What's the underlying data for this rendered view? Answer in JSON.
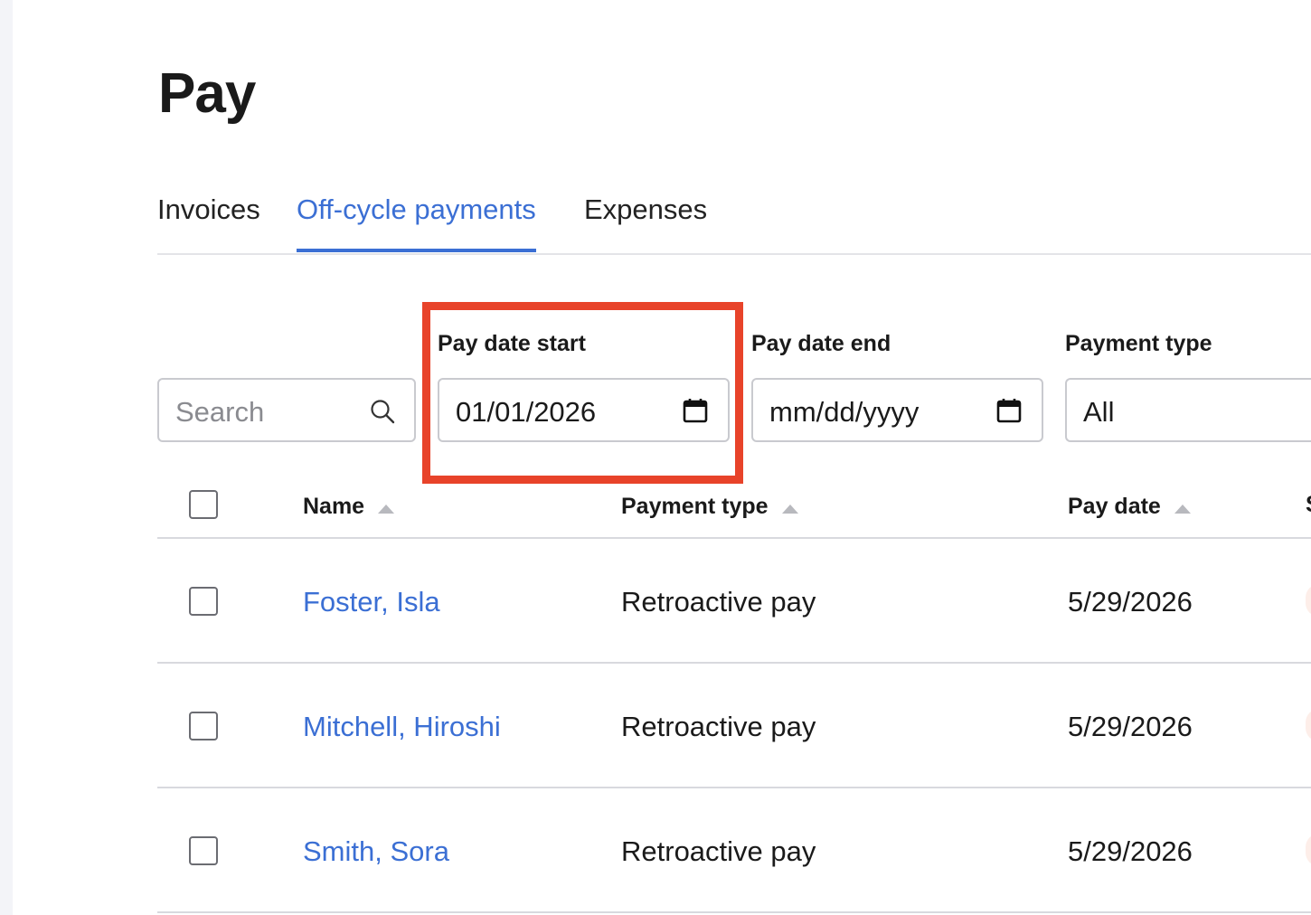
{
  "page": {
    "title": "Pay"
  },
  "tabs": [
    {
      "label": "Invoices",
      "active": false
    },
    {
      "label": "Off-cycle payments",
      "active": true
    },
    {
      "label": "Expenses",
      "active": false
    }
  ],
  "filters": {
    "search": {
      "placeholder": "Search",
      "value": ""
    },
    "pay_date_start": {
      "label": "Pay date start",
      "value": "01/01/2026"
    },
    "pay_date_end": {
      "label": "Pay date end",
      "placeholder": "mm/dd/yyyy"
    },
    "payment_type": {
      "label": "Payment type",
      "value": "All"
    }
  },
  "table": {
    "columns": [
      "Name",
      "Payment type",
      "Pay date",
      "S"
    ],
    "rows": [
      {
        "name": "Foster, Isla",
        "payment_type": "Retroactive pay",
        "pay_date": "5/29/2026"
      },
      {
        "name": "Mitchell, Hiroshi",
        "payment_type": "Retroactive pay",
        "pay_date": "5/29/2026"
      },
      {
        "name": "Smith, Sora",
        "payment_type": "Retroactive pay",
        "pay_date": "5/29/2026"
      }
    ]
  },
  "colors": {
    "accent": "#3b6fd4",
    "highlight": "#e8432a",
    "status_badge": "#fdeee9"
  }
}
